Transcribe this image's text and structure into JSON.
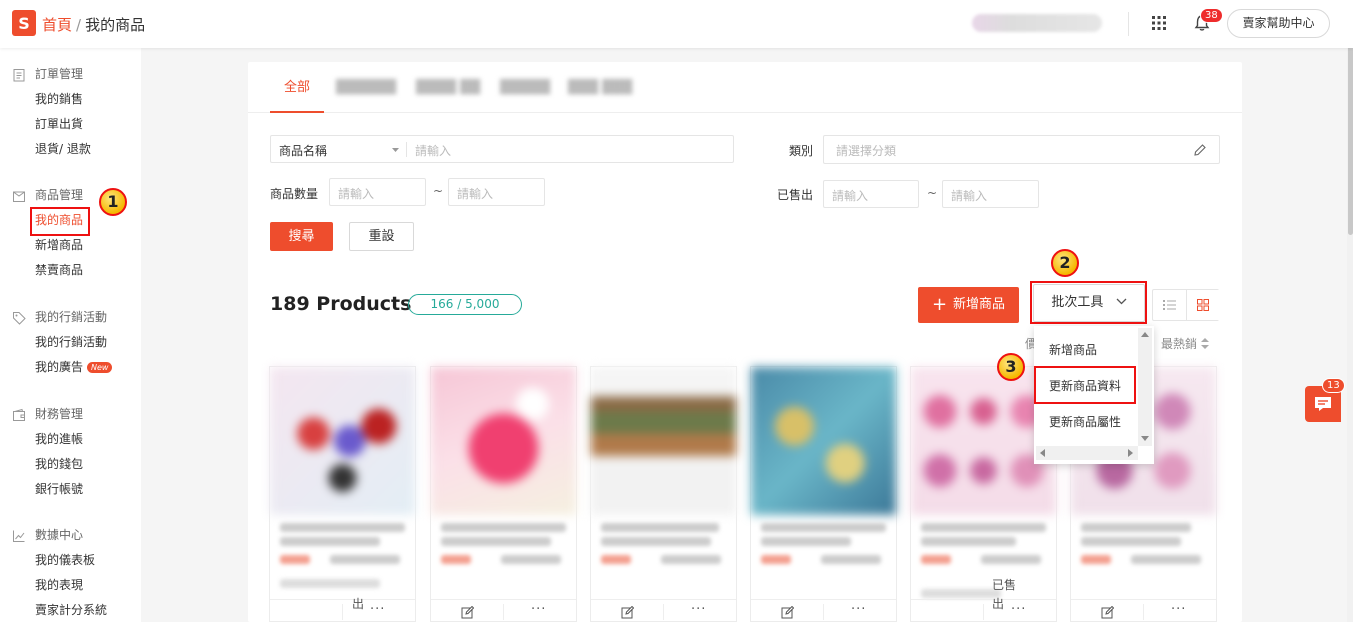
{
  "header": {
    "logo_letter": "S",
    "breadcrumb_home": "首頁",
    "breadcrumb_sep": "/",
    "breadcrumb_current": "我的商品",
    "notification_count": "38",
    "help_center": "賣家幫助中心"
  },
  "sidebar": {
    "groups": [
      {
        "title": "訂單管理",
        "icon": "clipboard-icon",
        "items": [
          "我的銷售",
          "訂單出貨",
          "退貨/ 退款"
        ]
      },
      {
        "title": "商品管理",
        "icon": "box-icon",
        "items": [
          "我的商品",
          "新增商品",
          "禁賣商品"
        ]
      },
      {
        "title": "我的行銷活動",
        "icon": "tag-icon",
        "items": [
          "我的行銷活動",
          "我的廣告"
        ]
      },
      {
        "title": "財務管理",
        "icon": "wallet-icon",
        "items": [
          "我的進帳",
          "我的錢包",
          "銀行帳號"
        ]
      },
      {
        "title": "數據中心",
        "icon": "chart-icon",
        "items": [
          "我的儀表板",
          "我的表現",
          "賣家計分系統"
        ]
      }
    ],
    "new_badge": "New"
  },
  "tabs": {
    "active": "全部"
  },
  "filters": {
    "name_select": "商品名稱",
    "name_placeholder": "請輸入",
    "category_label": "類別",
    "category_placeholder": "請選擇分類",
    "qty_label": "商品數量",
    "qty_min_placeholder": "請輸入",
    "qty_max_placeholder": "請輸入",
    "sold_label": "已售出",
    "sold_min_placeholder": "請輸入",
    "sold_max_placeholder": "請輸入",
    "tilde": "~",
    "search_button": "搜尋",
    "reset_button": "重設"
  },
  "products_bar": {
    "count_title": "189 Products",
    "quota": "166 / 5,000",
    "add_button": "新增商品",
    "add_plus": "+",
    "batch_button": "批次工具",
    "sort_partial": "價",
    "sort_best": "最熱銷"
  },
  "batch_menu": {
    "items": [
      "新增商品",
      "更新商品資料",
      "更新商品屬性"
    ]
  },
  "annotations": {
    "m1": "1",
    "m2": "2",
    "m3": "3"
  },
  "overlay": {
    "sold_partial_1": "出",
    "sold_partial_2": "已售",
    "sold_partial_3": "出"
  },
  "chat": {
    "badge": "13"
  },
  "colors": {
    "brand": "#ee4d2d",
    "teal": "#26aa99",
    "annotation": "#e11111"
  }
}
